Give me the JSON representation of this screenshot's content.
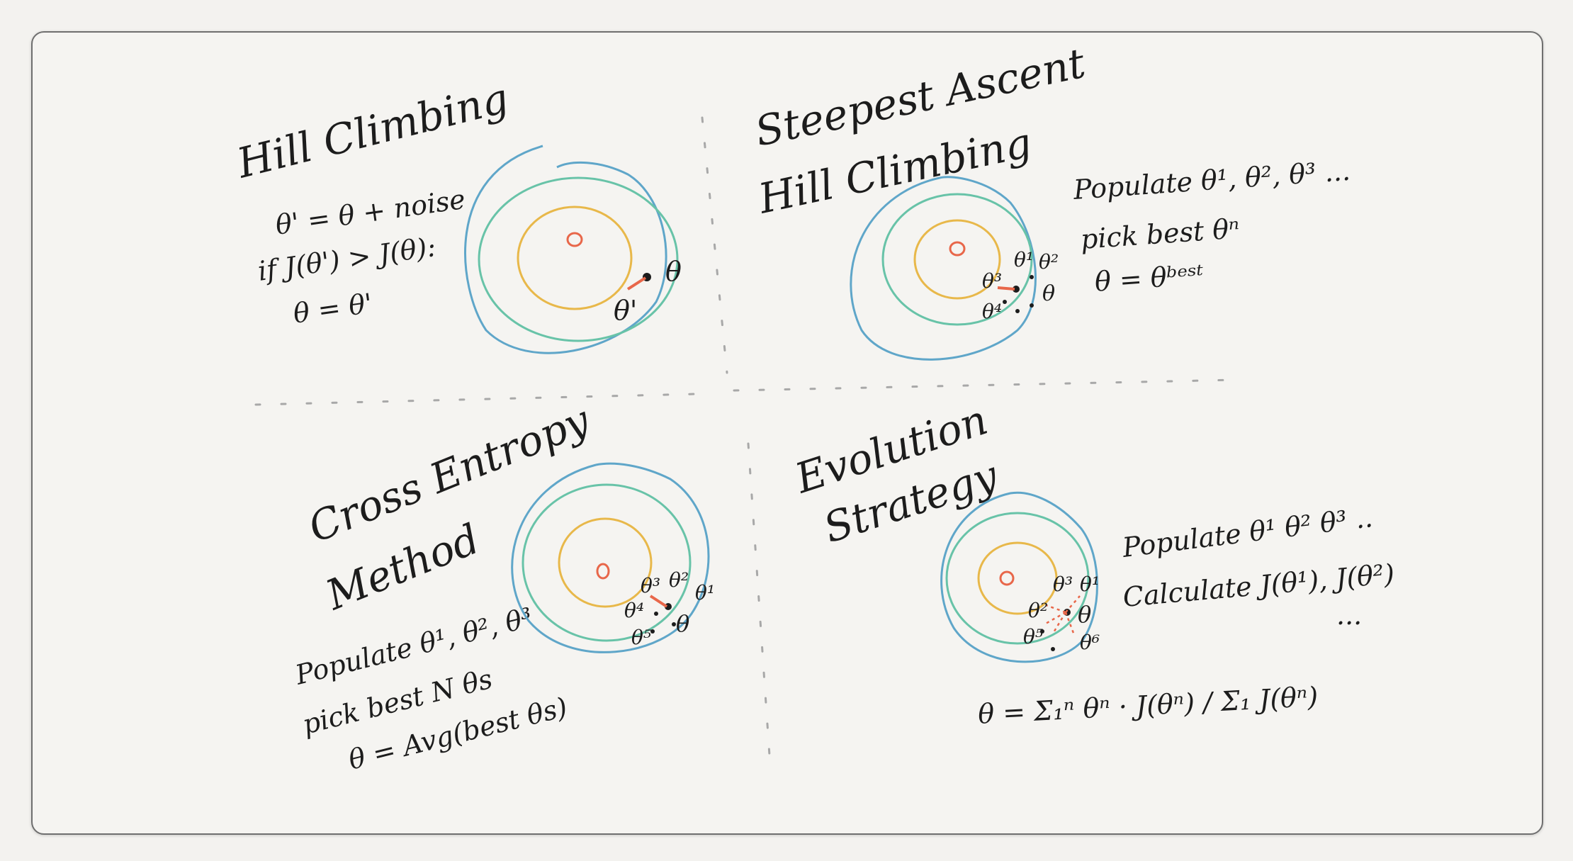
{
  "quadrants": {
    "hill_climbing": {
      "title": "Hill Climbing",
      "lines": [
        "θ' = θ + noise",
        "if J(θ') > J(θ):",
        "θ = θ'"
      ],
      "labels": [
        "θ",
        "θ'"
      ]
    },
    "steepest_ascent": {
      "title_line1": "Steepest Ascent",
      "title_line2": "Hill Climbing",
      "lines": [
        "Populate θ¹, θ², θ³ ...",
        "pick best θⁿ",
        "θ = θᵇᵉˢᵗ"
      ],
      "labels": [
        "θ³",
        "θ¹",
        "θ²",
        "θ",
        "θ⁴"
      ]
    },
    "cross_entropy": {
      "title_line1": "Cross Entropy",
      "title_line2": "Method",
      "lines": [
        "Populate θ¹, θ², θ³",
        "pick best N θs",
        "θ = Avg(best θs)"
      ],
      "labels": [
        "θ³",
        "θ²",
        "θ¹",
        "θ⁴",
        "θ",
        "θ⁵"
      ]
    },
    "evolution_strategy": {
      "title_line1": "Evolution",
      "title_line2": "Strategy",
      "lines": [
        "Populate θ¹ θ² θ³ ..",
        "Calculate J(θ¹), J(θ²)",
        "..."
      ],
      "formula": "θ = Σ₁ⁿ θⁿ · J(θⁿ) / Σ₁ J(θⁿ)",
      "labels": [
        "θ³",
        "θ¹",
        "θ²",
        "θ",
        "θ⁵",
        "θ⁶"
      ]
    }
  },
  "colors": {
    "outer_contour": "#5fa6c9",
    "middle_contour": "#68c3a8",
    "inner_contour": "#e8b84a",
    "optimum": "#e8674a",
    "arrow": "#e8674a",
    "ink": "#1c1c1c",
    "divider": "#a8a8a8"
  }
}
